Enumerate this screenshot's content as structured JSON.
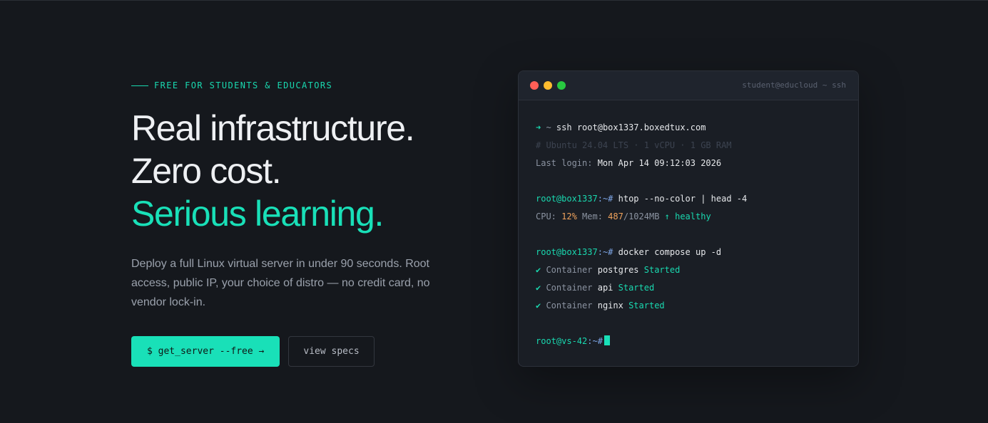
{
  "hero": {
    "eyebrow": "FREE FOR STUDENTS & EDUCATORS",
    "headline_line1": "Real infrastructure.",
    "headline_line2": "Zero cost.",
    "headline_line3": "Serious learning.",
    "lede": "Deploy a full Linux virtual server in under 90 seconds. Root access, public IP, your choice of distro — no credit card, no vendor lock-in.",
    "primary_button": "$ get_server --free →",
    "secondary_button": "view specs"
  },
  "terminal": {
    "title": "student@educloud ~ ssh",
    "lines": {
      "l1_arrow": "➜",
      "l1_tilde": " ~ ",
      "l1_cmd": "ssh root@box1337.boxedtux.com",
      "l2_comment": "# Ubuntu 24.04 LTS · 1 vCPU · 1 GB RAM",
      "l3_label": "Last login: ",
      "l3_value": "Mon Apr 14 09:12:03 2026",
      "l4_user": "root@box1337",
      "l4_sep": ":~#",
      "l4_cmd": " htop --no-color | head -4",
      "l5_cpu_label": "CPU: ",
      "l5_cpu_value": "12%",
      "l5_mem_label": " Mem: ",
      "l5_mem_value": "487",
      "l5_mem_total": "/1024MB ",
      "l5_status": "↑ healthy",
      "l6_user": "root@box1337",
      "l6_sep": ":~#",
      "l6_cmd": " docker compose up -d",
      "containers": [
        {
          "check": "✔",
          "label": " Container ",
          "name": "postgres",
          "status": " Started"
        },
        {
          "check": "✔",
          "label": " Container ",
          "name": "api",
          "status": " Started"
        },
        {
          "check": "✔",
          "label": " Container ",
          "name": "nginx",
          "status": " Started"
        }
      ],
      "l10_user": "root@vs-42",
      "l10_sep": ":~#"
    }
  },
  "colors": {
    "accent": "#19e0b8",
    "background": "#15181d",
    "terminal_bg": "#1a1e25"
  }
}
